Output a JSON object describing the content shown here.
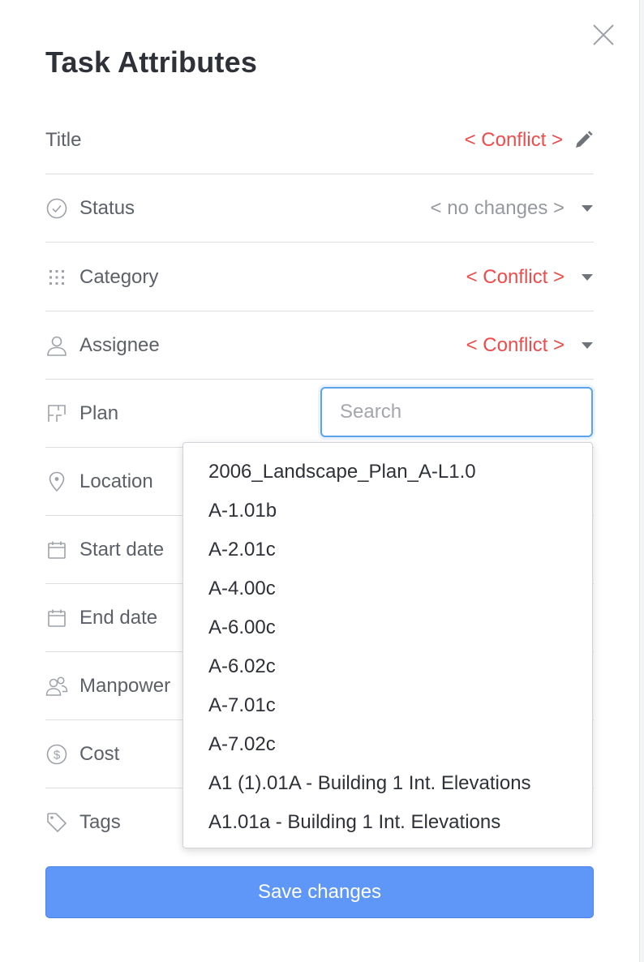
{
  "dialog": {
    "title": "Task Attributes",
    "close_icon": "close-icon"
  },
  "fields": {
    "title": {
      "label": "Title",
      "value": "< Conflict >",
      "action_icon": "pencil-icon"
    },
    "status": {
      "label": "Status",
      "value": "< no changes >",
      "icon": "check-circle-icon"
    },
    "category": {
      "label": "Category",
      "value": "< Conflict >",
      "icon": "grid-dots-icon"
    },
    "assignee": {
      "label": "Assignee",
      "value": "< Conflict >",
      "icon": "user-icon"
    },
    "plan": {
      "label": "Plan",
      "icon": "plan-icon",
      "search_placeholder": "Search"
    },
    "location": {
      "label": "Location",
      "icon": "location-pin-icon"
    },
    "start_date": {
      "label": "Start date",
      "icon": "calendar-icon"
    },
    "end_date": {
      "label": "End date",
      "icon": "calendar-icon"
    },
    "manpower": {
      "label": "Manpower",
      "icon": "people-icon"
    },
    "cost": {
      "label": "Cost",
      "icon": "dollar-circle-icon"
    },
    "tags": {
      "label": "Tags",
      "icon": "tag-icon"
    }
  },
  "plan_options": [
    "2006_Landscape_Plan_A-L1.0",
    "A-1.01b",
    "A-2.01c",
    "A-4.00c",
    "A-6.00c",
    "A-6.02c",
    "A-7.01c",
    "A-7.02c",
    "A1 (1).01A - Building 1 Int. Elevations",
    "A1.01a - Building 1 Int. Elevations"
  ],
  "footer": {
    "save_label": "Save changes"
  },
  "colors": {
    "conflict": "#f04a4a",
    "primary": "#5f97f8",
    "focus": "#5aa3ef"
  }
}
